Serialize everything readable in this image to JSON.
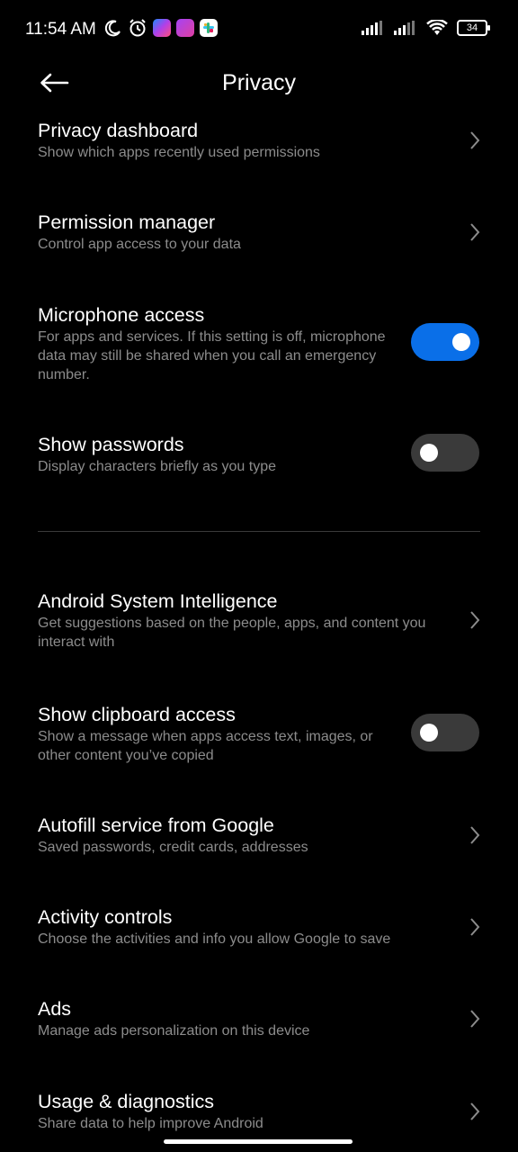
{
  "status_bar": {
    "time": "11:54 AM",
    "battery": "34",
    "icons": [
      "moon-icon",
      "alarm-icon",
      "messenger-icon",
      "app-p-icon",
      "slack-icon",
      "signal-icon",
      "wifi-icon",
      "battery-icon"
    ]
  },
  "header": {
    "title": "Privacy"
  },
  "items": [
    {
      "title": "Privacy dashboard",
      "subtitle": "Show which apps recently used permissions",
      "control": "chevron"
    },
    {
      "title": "Permission manager",
      "subtitle": "Control app access to your data",
      "control": "chevron"
    },
    {
      "title": "Microphone access",
      "subtitle": "For apps and services. If this setting is off, microphone data may still be shared when you call an emergency number.",
      "control": "toggle",
      "toggled": true
    },
    {
      "title": "Show passwords",
      "subtitle": "Display characters briefly as you type",
      "control": "toggle",
      "toggled": false
    },
    {
      "title": "Android System Intelligence",
      "subtitle": "Get suggestions based on the people, apps, and content you interact with",
      "control": "chevron"
    },
    {
      "title": "Show clipboard access",
      "subtitle": "Show a message when apps access text, images, or other content you’ve copied",
      "control": "toggle",
      "toggled": false
    },
    {
      "title": "Autofill service from Google",
      "subtitle": "Saved passwords, credit cards, addresses",
      "control": "chevron"
    },
    {
      "title": "Activity controls",
      "subtitle": "Choose the activities and info you allow Google to save",
      "control": "chevron"
    },
    {
      "title": "Ads",
      "subtitle": "Manage ads personalization on this device",
      "control": "chevron"
    },
    {
      "title": "Usage & diagnostics",
      "subtitle": "Share data to help improve Android",
      "control": "chevron"
    }
  ],
  "colors": {
    "accent": "#0a6fe8",
    "toggle_off": "#3a3a3a",
    "subtitle": "#8c8c8c",
    "background": "#000000"
  }
}
